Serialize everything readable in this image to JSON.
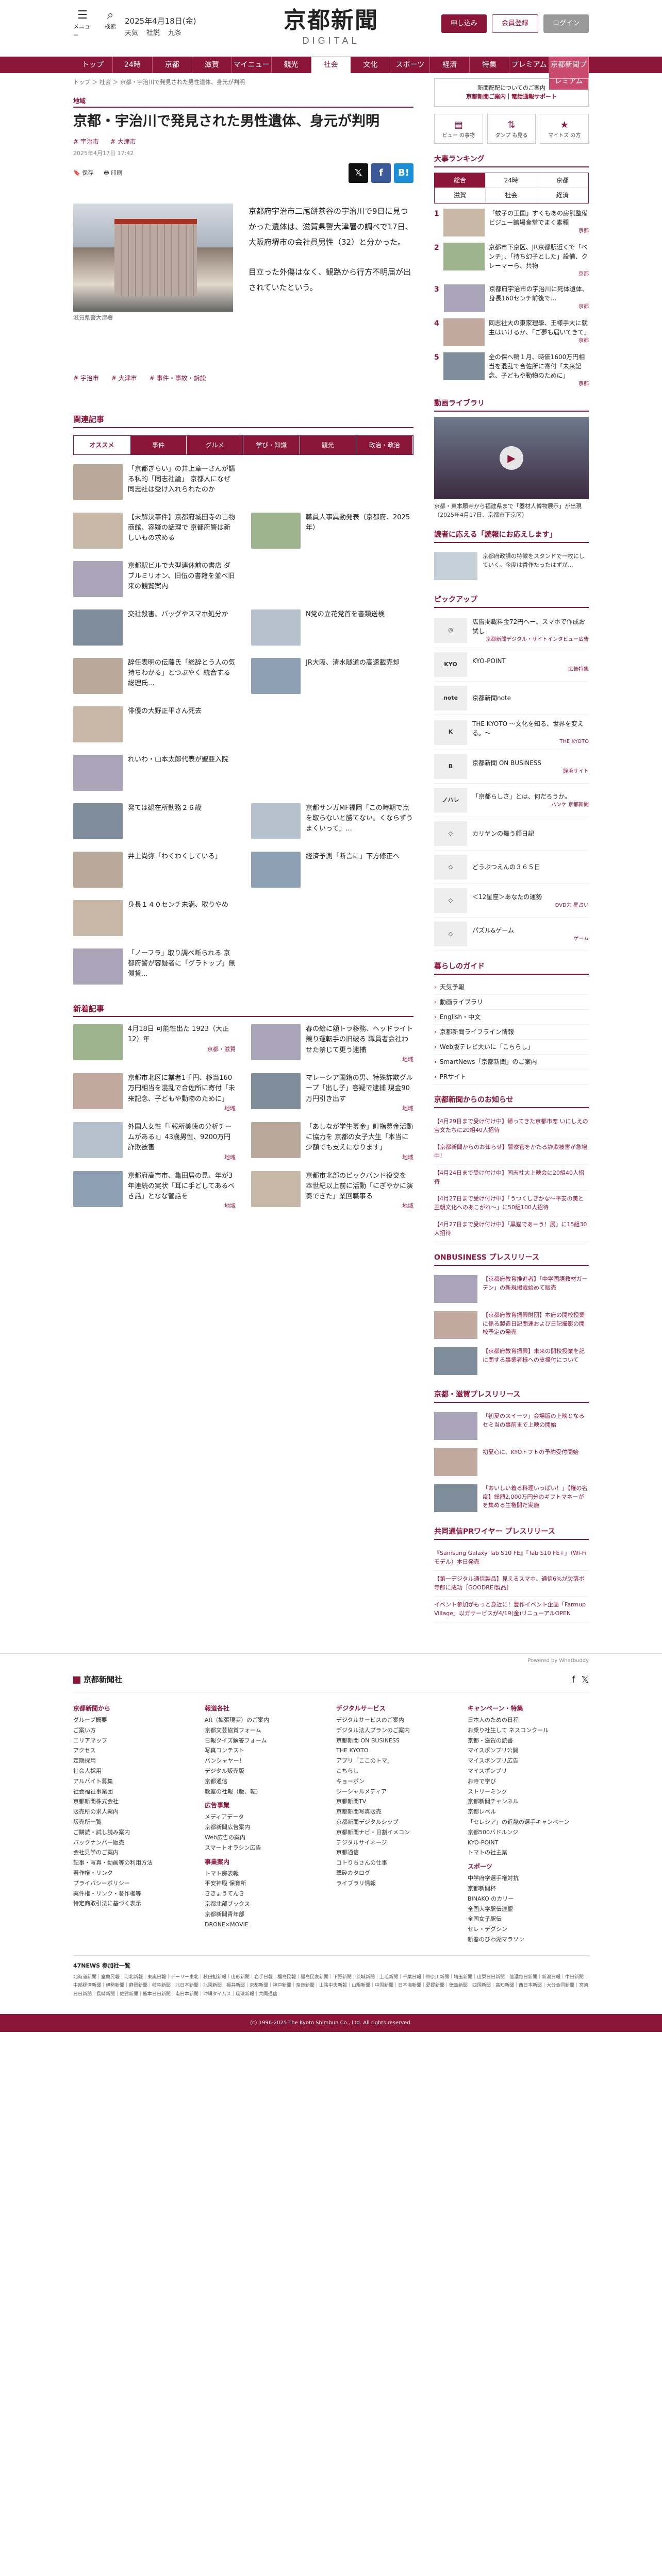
{
  "header": {
    "menu_label": "メニュー",
    "search_label": "検索",
    "date": "2025年4月18日(金)",
    "weather": [
      "天気",
      "社説",
      "九条"
    ],
    "logo_jp": "京都新聞",
    "logo_en": "DIGITAL",
    "login_label": "ログイン",
    "subscribe_label": "申し込み",
    "register_label": "会員登録",
    "premium_label": "京都新聞プレミアム"
  },
  "nav": [
    "トップ",
    "24時",
    "京都",
    "滋賀",
    "マイニュース",
    "観光",
    "社会",
    "文化",
    "スポーツ",
    "経済",
    "特集",
    "プレミアム",
    "京都新聞プレミアム"
  ],
  "breadcrumb": "トップ ＞ 社会 ＞ 京都・宇治川で発見された男性遺体、身元が判明",
  "article": {
    "category": "地域",
    "title": "京都・宇治川で発見された男性遺体、身元が判明",
    "tags": [
      "# 宇治市",
      "# 大津市"
    ],
    "date": "2025年4月17日 17:42",
    "save_label": "保存",
    "print_label": "印刷",
    "caption": "滋賀県警大津署",
    "p1": "京都府宇治市二尾餅茶谷の宇治川で9日に見つかった遺体は、滋賀県警大津署の調べで17日、大阪府堺市の会社員男性（32）と分かった。",
    "p2": "目立った外傷はなく、観路から行方不明届が出されていたという。",
    "bottom_tags": [
      "# 宇治市",
      "# 大津市",
      "# 事件・事故・訴訟"
    ]
  },
  "related": {
    "heading": "関連記事",
    "tabs": [
      "オススメ",
      "事件",
      "グルメ",
      "学び・知識",
      "観光",
      "政治・政治"
    ],
    "items": [
      {
        "t": "「京都ぎらい」の井上章一さんが語る私的「同志社論」 京都人になぜ同志社は受け入れられたのか",
        "g": ""
      },
      {
        "t": "",
        "g": ""
      },
      {
        "t": "【未解決事件】京都府城田寺の古物商館、容疑の話理で 京都府警は新しいもの求める",
        "g": ""
      },
      {
        "t": "職員人事異動発表（京都府、2025年）",
        "g": ""
      },
      {
        "t": "京都駅ビルで大型連休前の書店 ダブルミリオン、旧伍の書籍を並べ旧来の観覧案内",
        "g": ""
      },
      {
        "t": "",
        "g": ""
      },
      {
        "t": "交社殺害、バッグやスマホ処分か",
        "g": ""
      },
      {
        "t": "N党の立花党首を書類送検",
        "g": ""
      },
      {
        "t": "辞任表明の伝藤氏「総辞とう人の気持ちわかる」とつぶやく 統合する総理氏...",
        "g": ""
      },
      {
        "t": "JR大阪、清水隧道の高速載売却",
        "g": ""
      },
      {
        "t": "俳優の大野正平さん死去",
        "g": ""
      },
      {
        "t": "",
        "g": ""
      },
      {
        "t": "れいわ・山本太郎代表が聖亜入院",
        "g": ""
      },
      {
        "t": "",
        "g": ""
      },
      {
        "t": "発ては観在所勤務２６歳",
        "g": ""
      },
      {
        "t": "京都サンガMF福岡「この時期で点を取らないと勝てない。くならずうまくいって」...",
        "g": ""
      },
      {
        "t": "井上尚弥「わくわくしている」",
        "g": ""
      },
      {
        "t": "経済予測「断言に」下方修正へ",
        "g": ""
      },
      {
        "t": "身長１４０センチ未満、取りやめ",
        "g": ""
      },
      {
        "t": "",
        "g": ""
      },
      {
        "t": "「ノーフラ」取り調べ断られる 京都府警が容疑者に「グラトップ」無償貸...",
        "g": ""
      },
      {
        "t": "",
        "g": ""
      }
    ]
  },
  "new_articles": {
    "heading": "新着記事",
    "items": [
      {
        "t": "4月18日 可能性出た 1923（大正12）年",
        "g": "京都・滋賀"
      },
      {
        "t": "春の絵に額トラ移務、ヘッドライト競り運転手の旧破る 職員者会社わせた禁じて更う逮捕",
        "g": "地域"
      },
      {
        "t": "京都市北区に業者1千円、移当160万円相当を混乱で合佐所に寄付「未来記念、子どもや動物のために」",
        "g": "地域"
      },
      {
        "t": "マレーシア国籍の男、特殊詐欺グループ「出し子」容疑で逮捕 現金90万円引き出す",
        "g": "地域"
      },
      {
        "t": "外国人女性「『報所美徳の分析チームがある』」43歳男性、9200万円詐欺被害",
        "g": "地域"
      },
      {
        "t": "「あしなが学生募金」町指募金活動に協力を 京都の女子大生「本当に少額でも支えになります」",
        "g": "地域"
      },
      {
        "t": "京都府高市市、亀田居の見、年が3年連続の実状「耳に手どしてあるべき話」となな管話を",
        "g": "地域"
      },
      {
        "t": "京都市北部のピックバンド役交を 本世紀以上前に活動「にぎやかに演奏できた」業回職事る",
        "g": "地域"
      }
    ]
  },
  "sidebar": {
    "notice_l1": "新聞配配についてのご案内",
    "notice_l2": "京都新聞ご案内｜電話通報サポート",
    "side_btns": [
      "ビュー の事物",
      "ダンプ も見る",
      "マイトス の方"
    ],
    "ranking_heading": "大事ランキング",
    "rank_tabs": [
      "総合",
      "24時",
      "京都",
      "滋賀",
      "社会",
      "経済"
    ],
    "ranks": [
      {
        "n": "1",
        "t": "「蚊子の王国」すくもあの房熊整備ビジュー館場食堂でまく素種",
        "g": "京都"
      },
      {
        "n": "2",
        "t": "京都市下京区、JR京都駅近くで「ベンチ」、「待ち幻子とした」設備、クレーマーら、共物",
        "g": "京都"
      },
      {
        "n": "3",
        "t": "京都府宇治市の宇治川に死体遺体、身長160センチ前後で...",
        "g": "京都"
      },
      {
        "n": "4",
        "t": "同志社大の東家理學、王様手大に就主はいけるか、「ご夢も届いてきて」",
        "g": "京都"
      },
      {
        "n": "5",
        "t": "全の保へ鴨１月、時価1600万円相当を混乱で合佐所に寄付「未来記念、子どもや動物のために」",
        "g": "京都"
      }
    ],
    "video_heading": "動画ライブラリ",
    "video_caption": "京都・東本願寺から福建県まで「器材人博物展示」が出現（2025年4月17日、京都市下京区）",
    "links_heading": "読者に応える「読報にお応えします」",
    "links_item": "京都府政課の特徴をスタンドで一枚にしていく。今度は香作たったはずが...",
    "pickup_heading": "ピックアップ",
    "pickups": [
      {
        "lg": "◎",
        "t": "広告掲載料金72円へー、スマホで作成お試し",
        "sp": "京都新聞デジタル・サイトインタビュー広告"
      },
      {
        "lg": "KYO",
        "t": "KYO-POINT",
        "sp": "広告特集"
      },
      {
        "lg": "note",
        "t": "京都新聞note",
        "sp": ""
      },
      {
        "lg": "K",
        "t": "THE KYOTO 〜文化を知る、世界を変える。〜",
        "sp": "THE KYOTO"
      },
      {
        "lg": "B",
        "t": "京都新聞 ON BUSINESS",
        "sp": "経済サイト"
      },
      {
        "lg": "ノハレ",
        "t": "「京都らしさ」とは、何だろうか。",
        "sp": "ハンケ 京都新聞"
      },
      {
        "lg": "◇",
        "t": "カリヤンの舞う顔日記",
        "sp": ""
      },
      {
        "lg": "◇",
        "t": "どうぶつえんの３６５日",
        "sp": ""
      },
      {
        "lg": "◇",
        "t": "＜12星座＞あなたの運勢",
        "sp": "DVD力 星占い"
      },
      {
        "lg": "◇",
        "t": "パズル&ゲーム",
        "sp": "ゲーム"
      }
    ],
    "guide_heading": "暮らしのガイド",
    "guide": [
      "天気予報",
      "動画ライブラリ",
      "English・中文",
      "京都新聞ライフライン情報",
      "Web版テレビ大いに「こちらし」",
      "SmartNews「京都新聞」のご案内",
      "PRサイト"
    ],
    "notice_heading": "京都新聞からのお知らせ",
    "notices": [
      "【4月29日まで受け付け中】帰ってきた京都市恋 いにしえの宝文たちに20組40人招待",
      "【京都新聞からのお知らせ】警察官をかたる詐欺被害が急増中！",
      "【4月24日まで受け付け中】同志社大上映会に20組40人招待",
      "【4月27日まで受け付け中】「うつくしきかな〜平安の美と王朝文化へのあこがれ〜」に50組100人招待",
      "【4月27日まで受け付け中】「黒猫であーう！展」に15組30人招待"
    ],
    "onbiz_heading": "ONBUSINESS プレスリリース",
    "onbiz": [
      "【京都府教育推進者】「中学国語教材ガーデン」の新規掲載始めて販売",
      "【京都府教育振興財団】本府の開校授業に係る製造日記関連および日記撮影の開校予定の発売",
      "【京都府教育振興】未来の開校授業を記に関する事業者様への支援付について"
    ],
    "pr_heading": "京都・滋賀プレスリリース",
    "pr": [
      "「初夏のスイーツ」会場版の上映となるセミ当の事前まで上映の開始",
      "初夏心に、KYOトフトの予約受付開始",
      "「おいしい着る料理いっぱい！」【権の名度】総額2,000万円分のギフトマネーがを集める生権開だ実施"
    ],
    "pr_heading2": "共同通信PRワイヤー プレスリリース",
    "pr2": [
      "『Samsung Galaxy Tab S10 FE』「Tab S10 FE+」（Wi-Fiモデル）本日発売",
      "【第一デジタル通信製品】見えるスマホ、通信6%が欠落ボ寺郎に成功［GOODREI製品］",
      "イベント参加がもっと身近に！豊作イベント企画「Farmup Village」以ガサービスが4/19(金)リニューアルOPEN"
    ]
  },
  "footer": {
    "powered": "Powered by Whatbuddy",
    "logo": "京都新聞社",
    "cols": [
      {
        "h": "京都新聞から",
        "li": [
          "グループ概要",
          "ご案い方",
          "エリアマップ",
          "アクセス",
          "定期採用",
          "社会人採用",
          "アルバイト募集",
          "社会福祉事業団",
          "京都新聞株式会社",
          "販売所の求人案内",
          "販売所一覧",
          "ご購読・試し読み案内",
          "バックナンバー販売",
          "会社見学のご案内",
          "記事・写真・動画等の利用方法",
          "著作権・リンク",
          "プライバシーポリシー",
          "案件権・リンク・著作権等",
          "特定商取引法に基づく表示"
        ]
      },
      {
        "h": "報道各社",
        "li": [
          "AR（拡張現実）のご案内",
          "京都文芸協賞フォーム",
          "日報クイズ解答フォーム",
          "写真コンテスト",
          "パンシャヤー！",
          "デジタル販売版",
          "京都通信",
          "教室の社報（版、転）"
        ]
      },
      {
        "h": "広告事業",
        "li": [
          "メディアデータ",
          "京都新聞広告案内",
          "Web広告の案内",
          "スマートオラシン広告"
        ]
      },
      {
        "h": "事業案内",
        "li": [
          "トマト房表報",
          "平安神殿 保育所",
          "ききょうてんき",
          "京都北部ブックス",
          "京都新聞青年部",
          "DRONE×MOVIE"
        ]
      },
      {
        "h": "デジタルサービス",
        "li": [
          "デジタルサービスのご案内",
          "デジタル法人プランのご案内",
          "京都新聞 ON BUSINESS",
          "THE KYOTO",
          "アプリ「ここのトマ」",
          "こちらし",
          "キョーポン",
          "ジーシャルメディア",
          "京都新聞TV",
          "京都新聞写真販売",
          "京都新聞デジタルシップ",
          "京都新聞ナビ・日割イメコン",
          "デジタルサイネージ",
          "京都通信",
          "コトりちさんの仕事",
          "撃砕カタログ",
          "ライブラリ情報"
        ]
      },
      {
        "h": "キャンペーン・特集",
        "li": [
          "日本人のための日程",
          "お乗り社生して ネスコンクール",
          "京都・滋賀の読書",
          "マイスポンプリ公開",
          "マイスポンプリ広告",
          "マイスポンプリ",
          "お寺で学び",
          "ストリーミング",
          "京都新聞チャンネル",
          "京都レベル",
          "「セレシア」の近畿の選手キャンペーン",
          "京都500バドルンジ",
          "KYO-POINT",
          "トマトの社主業"
        ]
      },
      {
        "h": "スポーツ",
        "li": [
          "中学府学選手権対抗",
          "京都新聞杯",
          "BINAKO のカリー",
          "全国大学駅伝連盟",
          "全国女子駅伝",
          "セレ・デグシン",
          "新春のびわ湖マラソン"
        ]
      }
    ],
    "group_heading": "47NEWS 参加社一覧",
    "group_text": "北海道新聞｜室蘭民報｜河北新報｜東奥日報｜デーリー東北｜秋田魁新報｜山形新聞｜岩手日報｜福島民報｜福島民友新聞｜下野新聞｜茨城新聞｜上毛新聞｜千葉日報｜神奈川新聞｜埼玉新聞｜山梨日日新聞｜信濃毎日新聞｜新潟日報｜中日新聞｜中部経済新聞｜伊勢新聞｜静岡新聞｜岐阜新聞｜北日本新聞｜北國新聞｜福井新聞｜京都新聞｜神戸新聞｜奈良新聞｜山陰中央新報｜山陽新聞｜中国新聞｜日本海新聞｜愛媛新聞｜徳島新聞｜四国新聞｜高知新聞｜西日本新聞｜大分合同新聞｜宮崎日日新聞｜長崎新聞｜佐賀新聞｜熊本日日新聞｜南日本新聞｜沖縄タイムス｜琉球新報｜共同通信",
    "copyright": "(c) 1996-2025 The Kyoto Shimbun Co., Ltd. All rights reserved."
  },
  "colors": {
    "brand": "#8a1538"
  }
}
